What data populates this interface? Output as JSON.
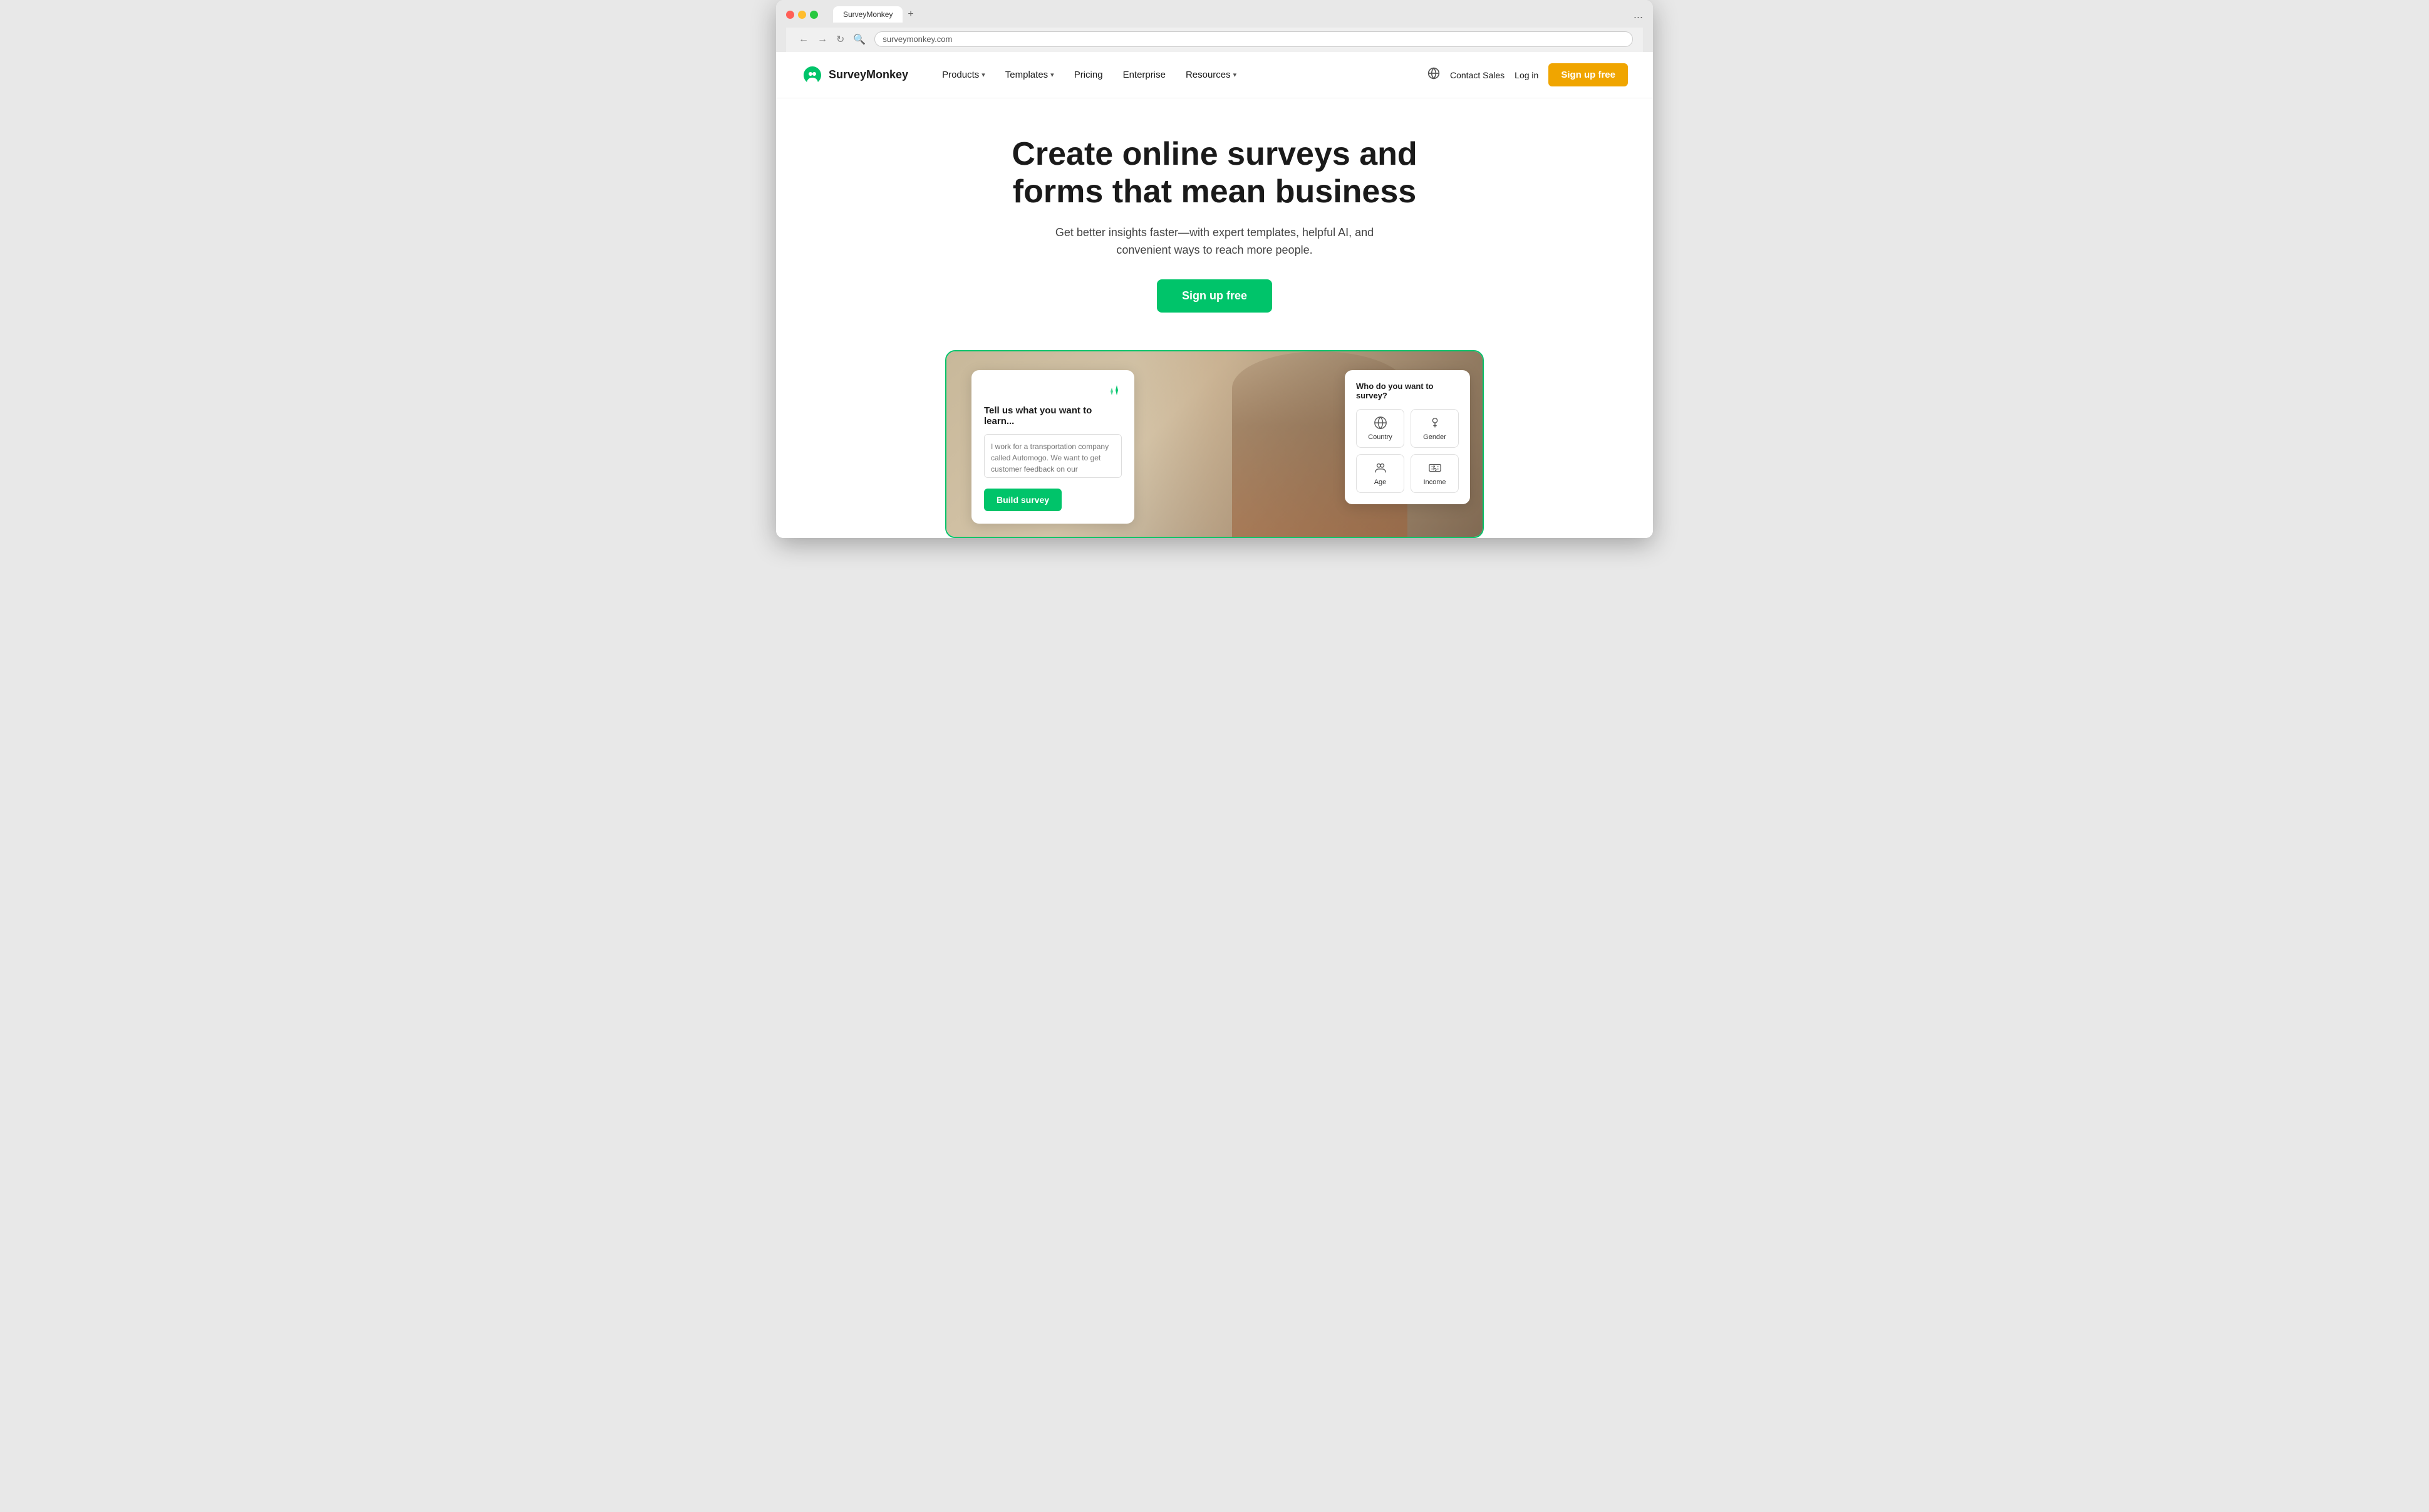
{
  "browser": {
    "tab_title": "SurveyMonkey",
    "tab_plus": "+",
    "address": "surveymonkey.com",
    "nav_back": "←",
    "nav_forward": "→",
    "nav_refresh": "↻",
    "nav_search": "🔍",
    "menu": "..."
  },
  "nav": {
    "logo_text": "SurveyMonkey",
    "items": [
      {
        "label": "Products",
        "has_dropdown": true
      },
      {
        "label": "Templates",
        "has_dropdown": true
      },
      {
        "label": "Pricing",
        "has_dropdown": false
      },
      {
        "label": "Enterprise",
        "has_dropdown": false
      },
      {
        "label": "Resources",
        "has_dropdown": true
      }
    ],
    "contact_sales": "Contact Sales",
    "login": "Log in",
    "signup": "Sign up free"
  },
  "hero": {
    "title": "Create online surveys and forms that mean business",
    "subtitle": "Get better insights faster—with expert templates, helpful AI, and convenient ways to reach more people.",
    "signup_btn": "Sign up free"
  },
  "demo": {
    "ai_card": {
      "title": "Tell us what you want to learn...",
      "textarea_placeholder": "I work for a transportation company called Automogo. We want to get customer feedback on our transportation booking ser...",
      "build_btn": "Build survey"
    },
    "survey_card": {
      "title": "Who do you want to survey?",
      "options": [
        {
          "label": "Country",
          "icon": "🌐"
        },
        {
          "label": "Gender",
          "icon": "👤"
        },
        {
          "label": "Age",
          "icon": "👥"
        },
        {
          "label": "Income",
          "icon": "💰"
        }
      ]
    }
  }
}
